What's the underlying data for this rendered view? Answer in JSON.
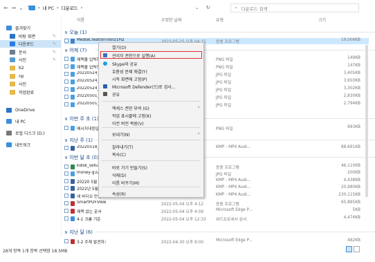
{
  "address": {
    "back": "←",
    "forward": "→",
    "dropdown": "⌄",
    "up": "↑",
    "crumbs": [
      "내 PC",
      "다운로드"
    ],
    "sep": "›",
    "refresh": "↻",
    "search_placeholder": "다운로드 검색"
  },
  "nav": {
    "items": [
      {
        "label": "즐겨찾기",
        "color": "#3b8fdc"
      },
      {
        "label": "바탕 화면",
        "color": "#2b74c9",
        "pin": true
      },
      {
        "label": "다운로드",
        "color": "#2a7de0",
        "pin": true,
        "selected": true
      },
      {
        "label": "문서",
        "color": "#6b7d8f",
        "pin": true
      },
      {
        "label": "사진",
        "color": "#5a9bd4",
        "pin": true
      },
      {
        "label": "b2",
        "color": "#e8b94a"
      },
      {
        "label": "np",
        "color": "#e8b94a"
      },
      {
        "label": "사진",
        "color": "#e8b94a"
      },
      {
        "label": "작업완료",
        "color": "#e8b94a"
      },
      {
        "label": "OneDrive",
        "color": "#2b74c9"
      },
      {
        "label": "내 PC",
        "color": "#3b8fdc"
      },
      {
        "label": "로컬 디스크 (D:)",
        "color": "#777777"
      },
      {
        "label": "네트워크",
        "color": "#3b8fdc"
      }
    ]
  },
  "columns": {
    "name": "이름",
    "date": "수정한 날짜",
    "type": "유형",
    "size": "크기"
  },
  "groups": [
    {
      "label": "∨ 오늘 (1)"
    },
    {
      "label": "∨ 어제 (7)"
    },
    {
      "label": "∨ 이번 주 초 (1)"
    },
    {
      "label": "∨ 지난 주 (1)"
    },
    {
      "label": "∨ 이번 달 초 (8)"
    },
    {
      "label": "∨ 지난 달 (6)"
    }
  ],
  "rows": [
    {
      "name": "MediaCreationTool21H2",
      "date": "2022-05-25 오후 04:15",
      "type": "응용 프로그램",
      "size": "19,008KB",
      "color": "#4a7fc1",
      "hl": true
    },
    {
      "name": "제목을 입력하세요",
      "date": "",
      "type": "PNG 파일",
      "size": "149KB",
      "color": "#4aa0e0"
    },
    {
      "name": "제목을 입력하세요",
      "date": "",
      "type": "PNG 파일",
      "size": "147KB",
      "color": "#4aa0e0"
    },
    {
      "name": "20220524_0",
      "date": "",
      "type": "JPG 파일",
      "size": "3,405KB",
      "color": "#4aa0e0"
    },
    {
      "name": "20220524_0",
      "date": "",
      "type": "JPG 파일",
      "size": "3,650KB",
      "color": "#4aa0e0"
    },
    {
      "name": "20220524_0",
      "date": "",
      "type": "JPG 파일",
      "size": "3,302KB",
      "color": "#4aa0e0"
    },
    {
      "name": "20220501_1",
      "date": "",
      "type": "JPG 파일",
      "size": "2,830KB",
      "color": "#4aa0e0"
    },
    {
      "name": "20220501_1",
      "date": "",
      "type": "JPG 파일",
      "size": "2,794KB",
      "color": "#4aa0e0"
    },
    {
      "name": "메시지대응답",
      "date": "",
      "type": "PNG 파일",
      "size": "693KB",
      "color": "#4aa0e0"
    },
    {
      "name": "20220518_15",
      "date": "",
      "type": "KMP - MP4 Audi...",
      "size": "88,691KB",
      "color": "#3a5fa0"
    },
    {
      "name": "kdisk_setup_n",
      "date": "",
      "type": "응용 프로그램",
      "size": "46,110KB",
      "color": "#2a8a4a"
    },
    {
      "name": "money-g323",
      "date": "",
      "type": "JPG 파일",
      "size": "200KB",
      "color": "#4aa0e0"
    },
    {
      "name": "20220 5월 4",
      "date": "",
      "type": "KMP - MP4 Audi...",
      "size": "4,438KB",
      "color": "#3a5fa0"
    },
    {
      "name": "2022년 5월 4",
      "date": "",
      "type": "KMP - MP4 Audi...",
      "size": "20,980KB",
      "color": "#3a5fa0"
    },
    {
      "name": "새 비디오 만들기",
      "date": "2022-05-04 오후 4:48",
      "type": "KMP - MP4 Audi...",
      "size": "230,115KB",
      "color": "#3a5fa0"
    },
    {
      "name": "SmartPDFViewer_5.3.6_Setup",
      "date": "2022-05-04 오후 4:12",
      "type": "응용 프로그램",
      "size": "65,885KB",
      "color": "#c03030"
    },
    {
      "name": "제목 없는 문서",
      "date": "2022-05-04 오후 4:09",
      "type": "Microsoft Edge P...",
      "size": "5KB",
      "color": "#c03030"
    },
    {
      "name": "4-1 크롬 기준",
      "date": "2022-05-04 오후 12:33",
      "type": "워드프로세서 문서",
      "size": "4,474KB",
      "color": "#3b8fdc"
    },
    {
      "name": "3-2 주제 발견하기",
      "date": "2022-04-30 오후 9:00",
      "type": "Microsoft Edge P...",
      "size": "482KB",
      "color": "#c03030"
    }
  ],
  "menu": [
    {
      "label": "열기(O)",
      "icon": "none"
    },
    {
      "label": "관리자 권한으로 실행(A)",
      "icon": "shield-icon",
      "color": "#3b6fc0"
    },
    {
      "label": "Skype와 공유",
      "icon": "skype-icon",
      "color": "#1aa0e0"
    },
    {
      "label": "호환성 문제 해결(Y)",
      "icon": "none"
    },
    {
      "label": "시작 화면에 고정(P)",
      "icon": "none"
    },
    {
      "label": "Microsoft Defender(으)로 검사...",
      "icon": "defender-icon",
      "color": "#2a5fb0"
    },
    {
      "label": "공유",
      "icon": "share-icon",
      "color": "#555555"
    },
    {
      "label": "액세스 권한 부여 (G)",
      "icon": "none",
      "sub": true
    },
    {
      "label": "작업 표시줄에 고정(K)",
      "icon": "none"
    },
    {
      "label": "이전 버전 복원(V)",
      "icon": "none"
    },
    {
      "label": "보내기(N)",
      "icon": "none",
      "sub": true
    },
    {
      "label": "잘라내기(T)",
      "icon": "none"
    },
    {
      "label": "복사(C)",
      "icon": "none"
    },
    {
      "label": "바로 가기 만들기(S)",
      "icon": "none"
    },
    {
      "label": "삭제(D)",
      "icon": "none"
    },
    {
      "label": "이름 바꾸기(M)",
      "icon": "none"
    },
    {
      "label": "속성(R)",
      "icon": "none"
    }
  ],
  "status": "28개 항목   1개 항목 선택함 18.5MB"
}
